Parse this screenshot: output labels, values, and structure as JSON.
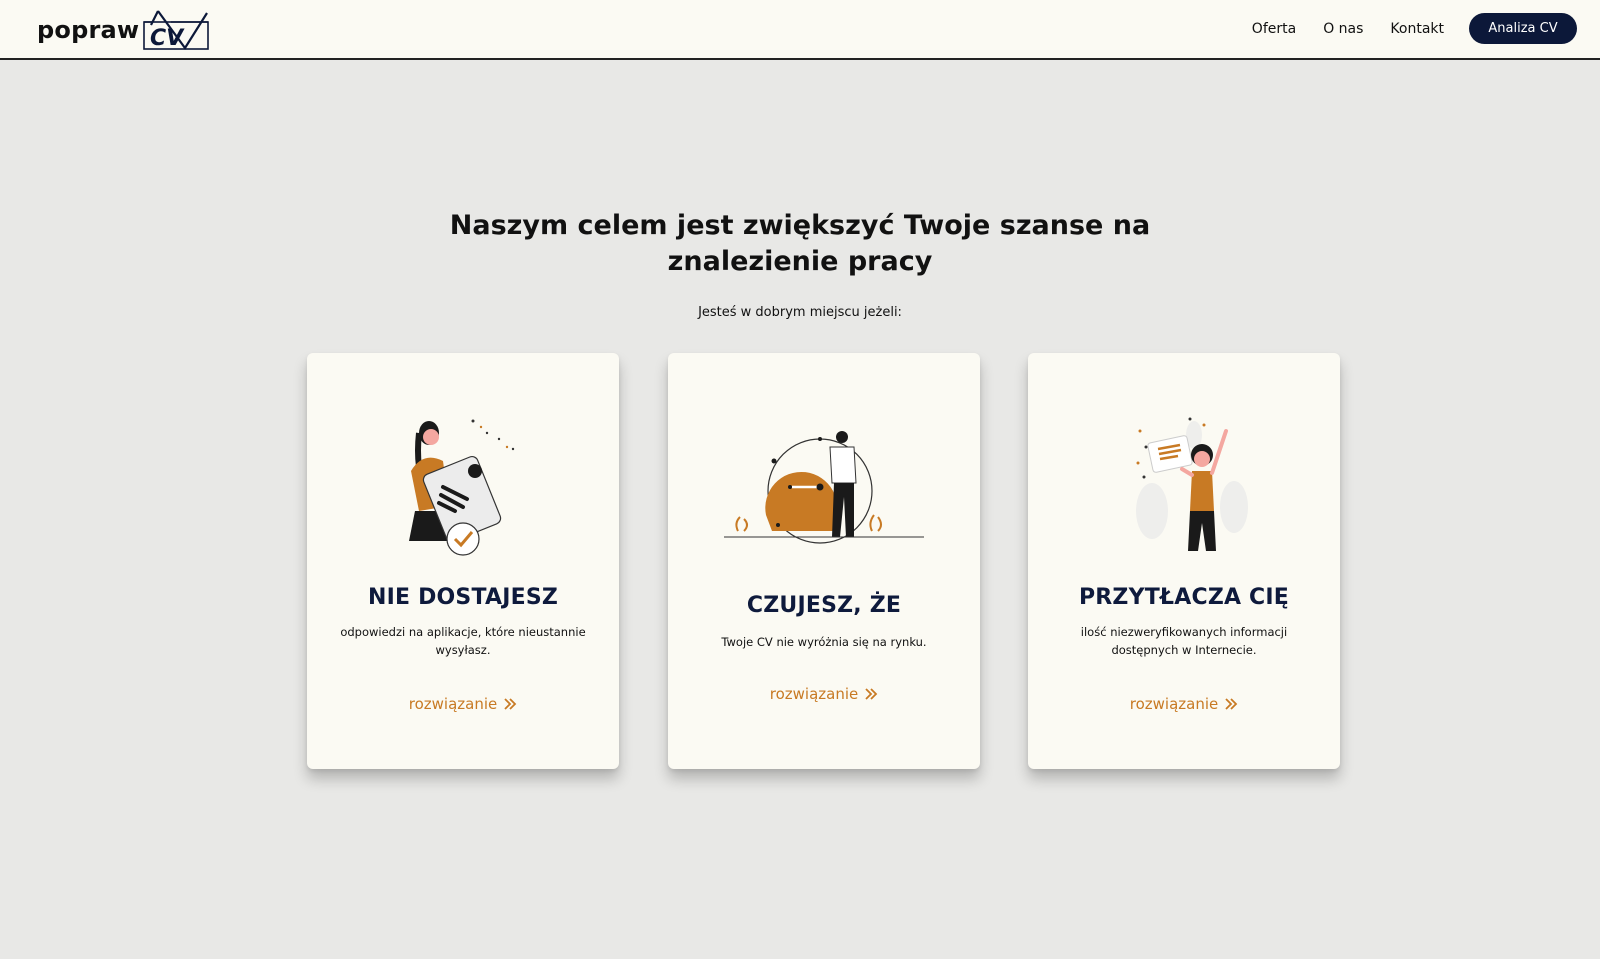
{
  "header": {
    "logo_text": "popraw",
    "logo_mark": "CV",
    "nav": [
      "Oferta",
      "O nas",
      "Kontakt"
    ],
    "cta_label": "Analiza CV"
  },
  "hero": {
    "title_line1": "Naszym celem jest zwiększyć Twoje szanse na",
    "title_line2": "znalezienie pracy",
    "subtitle": "Jesteś w dobrym miejscu jeżeli:"
  },
  "cards": [
    {
      "title": "NIE DOSTAJESZ",
      "text": "odpowiedzi na aplikacje, które nieustannie wysyłasz.",
      "link": "rozwiązanie",
      "icon": "chevron-double-right-icon"
    },
    {
      "title": "CZUJESZ, ŻE",
      "text": "Twoje CV nie wyróżnia się na rynku.",
      "link": "rozwiązanie",
      "icon": "chevron-double-right-icon"
    },
    {
      "title": "PRZYTŁACZA CIĘ",
      "text": "ilość niezweryfikowanych informacji dostępnych w Internecie.",
      "link": "rozwiązanie",
      "icon": "chevron-double-right-icon"
    }
  ],
  "colors": {
    "accent": "#c87a24",
    "navy": "#0c1839",
    "card_bg": "#fbfaf3",
    "page_bg": "#e8e8e6"
  }
}
